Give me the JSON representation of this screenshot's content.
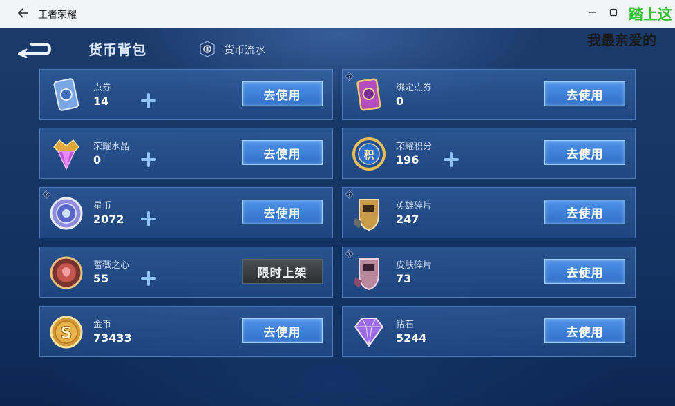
{
  "window": {
    "title": "王者荣耀",
    "overlay_top": "踏上这",
    "overlay_bottom": "我最亲爱的"
  },
  "header": {
    "title": "货币背包",
    "flow_label": "货币流水"
  },
  "colors": {
    "accent_blue": "#3f82de",
    "card_bg": "#2b5691",
    "text_light": "#cbd8ef"
  },
  "cards": [
    {
      "name": "点券",
      "value": "14",
      "button": "去使用",
      "icon": "coupon-card-icon"
    },
    {
      "name": "绑定点券",
      "value": "0",
      "button": "去使用",
      "icon": "bound-coupon-card-icon"
    },
    {
      "name": "荣耀水晶",
      "value": "0",
      "button": "去使用",
      "icon": "glory-crystal-icon"
    },
    {
      "name": "荣耀积分",
      "value": "196",
      "button": "去使用",
      "icon": "glory-points-icon"
    },
    {
      "name": "星币",
      "value": "2072",
      "button": "去使用",
      "icon": "star-coin-icon"
    },
    {
      "name": "英雄碎片",
      "value": "247",
      "button": "去使用",
      "icon": "hero-shard-icon"
    },
    {
      "name": "蔷薇之心",
      "value": "55",
      "button": "限时上架",
      "icon": "rose-heart-icon"
    },
    {
      "name": "皮肤碎片",
      "value": "73",
      "button": "去使用",
      "icon": "skin-shard-icon"
    },
    {
      "name": "金币",
      "value": "73433",
      "button": "去使用",
      "icon": "gold-coin-icon"
    },
    {
      "name": "钻石",
      "value": "5244",
      "button": "去使用",
      "icon": "diamond-icon"
    }
  ]
}
